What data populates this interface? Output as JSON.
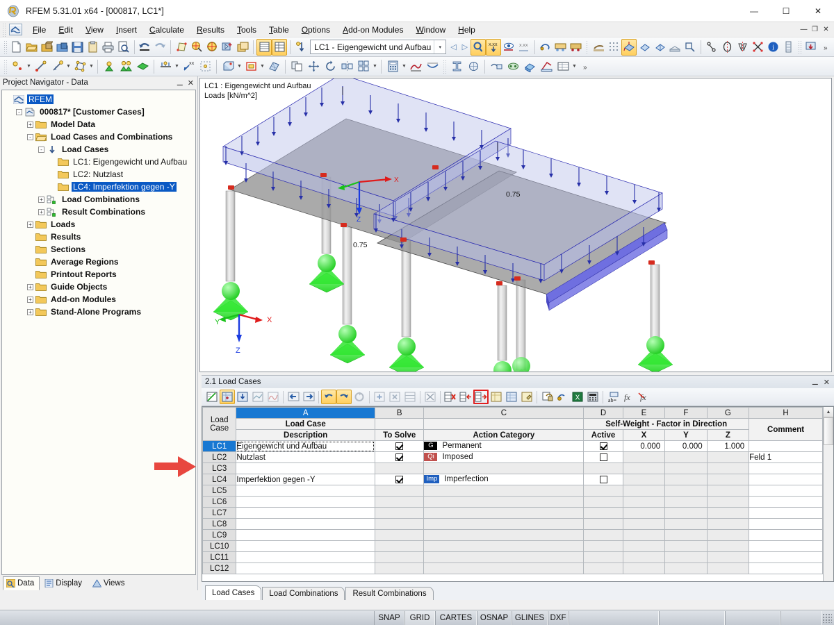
{
  "window": {
    "title": "RFEM 5.31.01 x64 - [000817, LC1*]",
    "app_icon": "rfem-logo-icon",
    "minimize": "—",
    "maximize": "☐",
    "close": "✕",
    "mdi_restore": "❐",
    "mdi_minimize": "—",
    "mdi_close": "✕"
  },
  "menu": {
    "items": [
      {
        "label": "File"
      },
      {
        "label": "Edit"
      },
      {
        "label": "View"
      },
      {
        "label": "Insert"
      },
      {
        "label": "Calculate"
      },
      {
        "label": "Results"
      },
      {
        "label": "Tools"
      },
      {
        "label": "Table"
      },
      {
        "label": "Options"
      },
      {
        "label": "Add-on Modules"
      },
      {
        "label": "Window"
      },
      {
        "label": "Help"
      }
    ]
  },
  "toolbar_main": {
    "load_case_combo": {
      "value": "LC1 - Eigengewicht und Aufbau",
      "arrow": "▾"
    },
    "nav_prev": "◁",
    "nav_next": "▷"
  },
  "viewport": {
    "label_line1": "LC1 : Eigengewicht und Aufbau",
    "label_line2": "Loads [kN/m^2]",
    "load_value_left": "0.75",
    "load_value_right": "0.75",
    "axis_x": "X",
    "axis_y": "Y",
    "axis_z": "Z"
  },
  "navigator": {
    "title": "Project Navigator - Data",
    "pin_icon": "⚊",
    "close_icon": "✕",
    "tree": [
      {
        "label": "RFEM",
        "depth": 0,
        "expander": "",
        "icon": "rfem-icon",
        "selected": true,
        "bold": false
      },
      {
        "label": "000817* [Customer Cases]",
        "depth": 1,
        "expander": "-",
        "icon": "model-icon",
        "selected": false,
        "bold": true
      },
      {
        "label": "Model Data",
        "depth": 2,
        "expander": "+",
        "icon": "folder",
        "selected": false,
        "bold": true
      },
      {
        "label": "Load Cases and Combinations",
        "depth": 2,
        "expander": "-",
        "icon": "folder-open",
        "selected": false,
        "bold": true
      },
      {
        "label": "Load Cases",
        "depth": 3,
        "expander": "-",
        "icon": "loadcase-icon",
        "selected": false,
        "bold": true
      },
      {
        "label": "LC1: Eigengewicht und Aufbau",
        "depth": 4,
        "expander": "",
        "icon": "folder",
        "selected": false,
        "bold": false
      },
      {
        "label": "LC2: Nutzlast",
        "depth": 4,
        "expander": "",
        "icon": "folder",
        "selected": false,
        "bold": false
      },
      {
        "label": "LC4: Imperfektion gegen -Y",
        "depth": 4,
        "expander": "",
        "icon": "folder",
        "selected": true,
        "bold": false
      },
      {
        "label": "Load Combinations",
        "depth": 3,
        "expander": "+",
        "icon": "combination-icon",
        "selected": false,
        "bold": true
      },
      {
        "label": "Result Combinations",
        "depth": 3,
        "expander": "+",
        "icon": "combination-icon",
        "selected": false,
        "bold": true
      },
      {
        "label": "Loads",
        "depth": 2,
        "expander": "+",
        "icon": "folder",
        "selected": false,
        "bold": true
      },
      {
        "label": "Results",
        "depth": 2,
        "expander": "",
        "icon": "folder",
        "selected": false,
        "bold": true
      },
      {
        "label": "Sections",
        "depth": 2,
        "expander": "",
        "icon": "folder",
        "selected": false,
        "bold": true
      },
      {
        "label": "Average Regions",
        "depth": 2,
        "expander": "",
        "icon": "folder",
        "selected": false,
        "bold": true
      },
      {
        "label": "Printout Reports",
        "depth": 2,
        "expander": "",
        "icon": "folder",
        "selected": false,
        "bold": true
      },
      {
        "label": "Guide Objects",
        "depth": 2,
        "expander": "+",
        "icon": "folder",
        "selected": false,
        "bold": true
      },
      {
        "label": "Add-on Modules",
        "depth": 2,
        "expander": "+",
        "icon": "folder",
        "selected": false,
        "bold": true
      },
      {
        "label": "Stand-Alone Programs",
        "depth": 2,
        "expander": "+",
        "icon": "folder",
        "selected": false,
        "bold": true
      }
    ],
    "tabs": [
      {
        "label": "Data",
        "icon": "data-icon",
        "active": true
      },
      {
        "label": "Display",
        "icon": "display-icon",
        "active": false
      },
      {
        "label": "Views",
        "icon": "views-icon",
        "active": false
      }
    ]
  },
  "table_panel": {
    "title": "2.1 Load Cases",
    "pin_icon": "⚊",
    "close_icon": "✕",
    "columns": [
      {
        "letter": "",
        "head1": "Load",
        "head2": "Case",
        "selected": false
      },
      {
        "letter": "A",
        "head1": "Load Case",
        "head2": "Description",
        "selected": true
      },
      {
        "letter": "B",
        "head1": "",
        "head2": "To Solve",
        "selected": false
      },
      {
        "letter": "C",
        "head1": "",
        "head2": "Action Category",
        "selected": false
      },
      {
        "letter": "D",
        "head1": "",
        "head2": "Active",
        "selected": false
      },
      {
        "letter": "E",
        "head1": "",
        "head2": "X",
        "selected": false
      },
      {
        "letter": "F",
        "head1": "",
        "head2": "Y",
        "selected": false
      },
      {
        "letter": "G",
        "head1": "",
        "head2": "Z",
        "selected": false
      },
      {
        "letter": "H",
        "head1": "",
        "head2": "Comment",
        "selected": false
      }
    ],
    "group_header": "Self-Weight  -  Factor in Direction",
    "rows": [
      {
        "id": "LC1",
        "selected": true,
        "empty": false,
        "focus": true,
        "description": "Eigengewicht und Aufbau",
        "to_solve": true,
        "category_badge": "G",
        "category_color": "#000000",
        "category": "Permanent",
        "active": true,
        "x": "0.000",
        "y": "0.000",
        "z": "1.000",
        "comment": ""
      },
      {
        "id": "LC2",
        "selected": false,
        "empty": false,
        "focus": false,
        "description": "Nutzlast",
        "to_solve": true,
        "category_badge": "Qi",
        "category_color": "#c0504d",
        "category": "Imposed",
        "active": false,
        "x": "",
        "y": "",
        "z": "",
        "comment": "Feld 1"
      },
      {
        "id": "LC3",
        "selected": false,
        "empty": true,
        "focus": false,
        "description": "",
        "to_solve": null,
        "category_badge": "",
        "category_color": "",
        "category": "",
        "active": null,
        "x": "",
        "y": "",
        "z": "",
        "comment": ""
      },
      {
        "id": "LC4",
        "selected": false,
        "empty": false,
        "focus": false,
        "description": "Imperfektion gegen -Y",
        "to_solve": true,
        "category_badge": "Imp",
        "category_color": "#1f5fbf",
        "category": "Imperfection",
        "active": false,
        "x": "",
        "y": "",
        "z": "",
        "comment": ""
      },
      {
        "id": "LC5",
        "selected": false,
        "empty": true,
        "focus": false,
        "description": "",
        "to_solve": null,
        "category_badge": "",
        "category_color": "",
        "category": "",
        "active": null,
        "x": "",
        "y": "",
        "z": "",
        "comment": ""
      },
      {
        "id": "LC6",
        "selected": false,
        "empty": true,
        "focus": false,
        "description": "",
        "to_solve": null,
        "category_badge": "",
        "category_color": "",
        "category": "",
        "active": null,
        "x": "",
        "y": "",
        "z": "",
        "comment": ""
      },
      {
        "id": "LC7",
        "selected": false,
        "empty": true,
        "focus": false,
        "description": "",
        "to_solve": null,
        "category_badge": "",
        "category_color": "",
        "category": "",
        "active": null,
        "x": "",
        "y": "",
        "z": "",
        "comment": ""
      },
      {
        "id": "LC8",
        "selected": false,
        "empty": true,
        "focus": false,
        "description": "",
        "to_solve": null,
        "category_badge": "",
        "category_color": "",
        "category": "",
        "active": null,
        "x": "",
        "y": "",
        "z": "",
        "comment": ""
      },
      {
        "id": "LC9",
        "selected": false,
        "empty": true,
        "focus": false,
        "description": "",
        "to_solve": null,
        "category_badge": "",
        "category_color": "",
        "category": "",
        "active": null,
        "x": "",
        "y": "",
        "z": "",
        "comment": ""
      },
      {
        "id": "LC10",
        "selected": false,
        "empty": true,
        "focus": false,
        "description": "",
        "to_solve": null,
        "category_badge": "",
        "category_color": "",
        "category": "",
        "active": null,
        "x": "",
        "y": "",
        "z": "",
        "comment": ""
      },
      {
        "id": "LC11",
        "selected": false,
        "empty": true,
        "focus": false,
        "description": "",
        "to_solve": null,
        "category_badge": "",
        "category_color": "",
        "category": "",
        "active": null,
        "x": "",
        "y": "",
        "z": "",
        "comment": ""
      },
      {
        "id": "LC12",
        "selected": false,
        "empty": true,
        "focus": false,
        "description": "",
        "to_solve": null,
        "category_badge": "",
        "category_color": "",
        "category": "",
        "active": null,
        "x": "",
        "y": "",
        "z": "",
        "comment": ""
      }
    ],
    "tabs": [
      {
        "label": "Load Cases",
        "active": true
      },
      {
        "label": "Load Combinations",
        "active": false
      },
      {
        "label": "Result Combinations",
        "active": false
      }
    ],
    "scroll_up": "▲",
    "scroll_down": "▼"
  },
  "statusbar": {
    "segments": [
      "SNAP",
      "GRID",
      "CARTES",
      "OSNAP",
      "GLINES",
      "DXF"
    ],
    "active_segment": "GRID"
  },
  "annotation": {
    "arrow_color": "#e8473f",
    "arrow_name": "pointer-arrow"
  },
  "colors": {
    "selection_blue": "#1878d2",
    "title_bg": "#ffffff",
    "toolbar_bg": "#eef1f5",
    "accent_orange": "#ffcf5e"
  }
}
